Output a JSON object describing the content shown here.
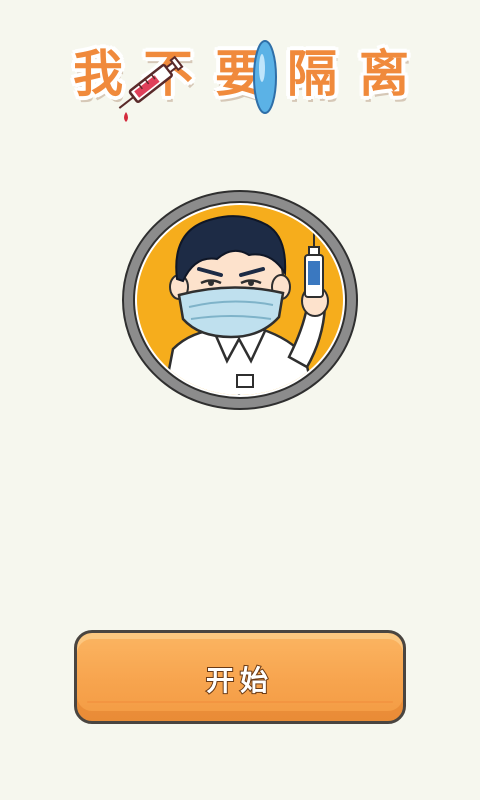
{
  "game": {
    "title_chars": [
      "我",
      "不",
      "要",
      "隔",
      "离"
    ],
    "start_button_label": "开始"
  },
  "decorations": {
    "title_icons": [
      "syringe-icon",
      "capsule-icon"
    ],
    "avatar": "masked-doctor-with-syringe"
  },
  "colors": {
    "background": "#f6f7ee",
    "title_fill": "#f08a3c",
    "avatar_ring": "#8a8a8a",
    "avatar_bg": "#f6ad1c",
    "button_fill": "#f7a44e",
    "mask": "#bfe0ee"
  }
}
